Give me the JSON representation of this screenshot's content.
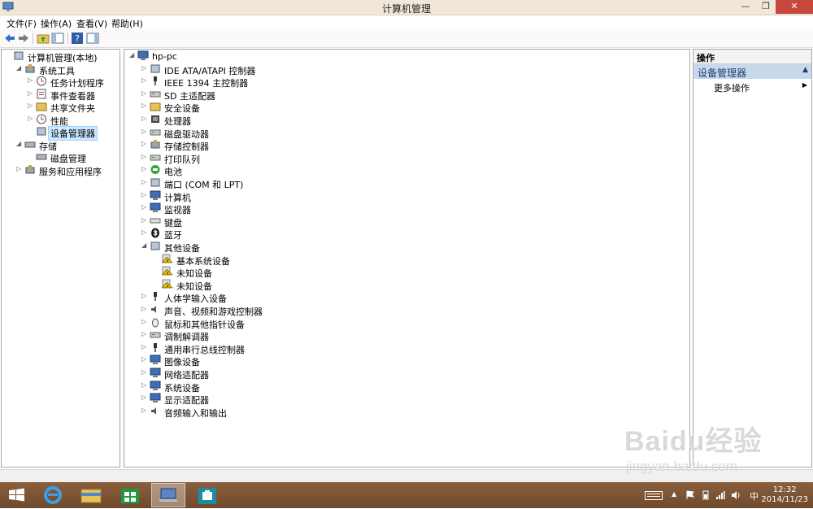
{
  "window": {
    "title": "计算机管理"
  },
  "menu": [
    "文件(F)",
    "操作(A)",
    "查看(V)",
    "帮助(H)"
  ],
  "left_tree": [
    {
      "label": "计算机管理(本地)",
      "indent": 0,
      "arrow": "",
      "icon": "computer-management-icon"
    },
    {
      "label": "系统工具",
      "indent": 1,
      "arrow": "◢",
      "icon": "system-tools-icon"
    },
    {
      "label": "任务计划程序",
      "indent": 2,
      "arrow": "▷",
      "icon": "task-scheduler-icon"
    },
    {
      "label": "事件查看器",
      "indent": 2,
      "arrow": "▷",
      "icon": "event-viewer-icon"
    },
    {
      "label": "共享文件夹",
      "indent": 2,
      "arrow": "▷",
      "icon": "shared-folders-icon"
    },
    {
      "label": "性能",
      "indent": 2,
      "arrow": "▷",
      "icon": "performance-icon"
    },
    {
      "label": "设备管理器",
      "indent": 2,
      "arrow": "",
      "icon": "device-manager-icon",
      "selected": true
    },
    {
      "label": "存储",
      "indent": 1,
      "arrow": "◢",
      "icon": "storage-icon"
    },
    {
      "label": "磁盘管理",
      "indent": 2,
      "arrow": "",
      "icon": "disk-management-icon"
    },
    {
      "label": "服务和应用程序",
      "indent": 1,
      "arrow": "▷",
      "icon": "services-apps-icon"
    }
  ],
  "device_tree": [
    {
      "label": "hp-pc",
      "indent": 0,
      "arrow": "◢",
      "icon": "computer-icon"
    },
    {
      "label": "IDE ATA/ATAPI 控制器",
      "indent": 1,
      "arrow": "▷",
      "icon": "ide-controller-icon"
    },
    {
      "label": "IEEE 1394 主控制器",
      "indent": 1,
      "arrow": "▷",
      "icon": "firewire-icon"
    },
    {
      "label": "SD 主适配器",
      "indent": 1,
      "arrow": "▷",
      "icon": "sd-adapter-icon"
    },
    {
      "label": "安全设备",
      "indent": 1,
      "arrow": "▷",
      "icon": "security-device-icon"
    },
    {
      "label": "处理器",
      "indent": 1,
      "arrow": "▷",
      "icon": "processor-icon"
    },
    {
      "label": "磁盘驱动器",
      "indent": 1,
      "arrow": "▷",
      "icon": "disk-drive-icon"
    },
    {
      "label": "存储控制器",
      "indent": 1,
      "arrow": "▷",
      "icon": "storage-controller-icon"
    },
    {
      "label": "打印队列",
      "indent": 1,
      "arrow": "▷",
      "icon": "printer-icon"
    },
    {
      "label": "电池",
      "indent": 1,
      "arrow": "▷",
      "icon": "battery-icon"
    },
    {
      "label": "端口 (COM 和 LPT)",
      "indent": 1,
      "arrow": "▷",
      "icon": "port-icon"
    },
    {
      "label": "计算机",
      "indent": 1,
      "arrow": "▷",
      "icon": "computer-icon"
    },
    {
      "label": "监视器",
      "indent": 1,
      "arrow": "▷",
      "icon": "monitor-icon"
    },
    {
      "label": "键盘",
      "indent": 1,
      "arrow": "▷",
      "icon": "keyboard-icon"
    },
    {
      "label": "蓝牙",
      "indent": 1,
      "arrow": "▷",
      "icon": "bluetooth-icon"
    },
    {
      "label": "其他设备",
      "indent": 1,
      "arrow": "◢",
      "icon": "other-devices-icon"
    },
    {
      "label": "基本系统设备",
      "indent": 2,
      "arrow": "",
      "icon": "warning-device-icon"
    },
    {
      "label": "未知设备",
      "indent": 2,
      "arrow": "",
      "icon": "warning-device-icon"
    },
    {
      "label": "未知设备",
      "indent": 2,
      "arrow": "",
      "icon": "warning-device-icon"
    },
    {
      "label": "人体学输入设备",
      "indent": 1,
      "arrow": "▷",
      "icon": "hid-icon"
    },
    {
      "label": "声音、视频和游戏控制器",
      "indent": 1,
      "arrow": "▷",
      "icon": "sound-icon"
    },
    {
      "label": "鼠标和其他指针设备",
      "indent": 1,
      "arrow": "▷",
      "icon": "mouse-icon"
    },
    {
      "label": "调制解调器",
      "indent": 1,
      "arrow": "▷",
      "icon": "modem-icon"
    },
    {
      "label": "通用串行总线控制器",
      "indent": 1,
      "arrow": "▷",
      "icon": "usb-icon"
    },
    {
      "label": "图像设备",
      "indent": 1,
      "arrow": "▷",
      "icon": "imaging-icon"
    },
    {
      "label": "网络适配器",
      "indent": 1,
      "arrow": "▷",
      "icon": "network-adapter-icon"
    },
    {
      "label": "系统设备",
      "indent": 1,
      "arrow": "▷",
      "icon": "system-device-icon"
    },
    {
      "label": "显示适配器",
      "indent": 1,
      "arrow": "▷",
      "icon": "display-adapter-icon"
    },
    {
      "label": "音频输入和输出",
      "indent": 1,
      "arrow": "▷",
      "icon": "audio-io-icon"
    }
  ],
  "actions": {
    "header": "操作",
    "section": "设备管理器",
    "more": "更多操作"
  },
  "taskbar": {
    "time": "12:32",
    "date": "2014/11/23",
    "ime": "中"
  },
  "watermark": {
    "brand": "Baidu经验",
    "url": "jingyan.baidu.com"
  },
  "colors": {
    "titlebar": "#f0e7d8",
    "close_button": "#c7473d",
    "taskbar": "#7a5233",
    "selection": "#cde8ff",
    "actions_section": "#c8d9ee"
  }
}
